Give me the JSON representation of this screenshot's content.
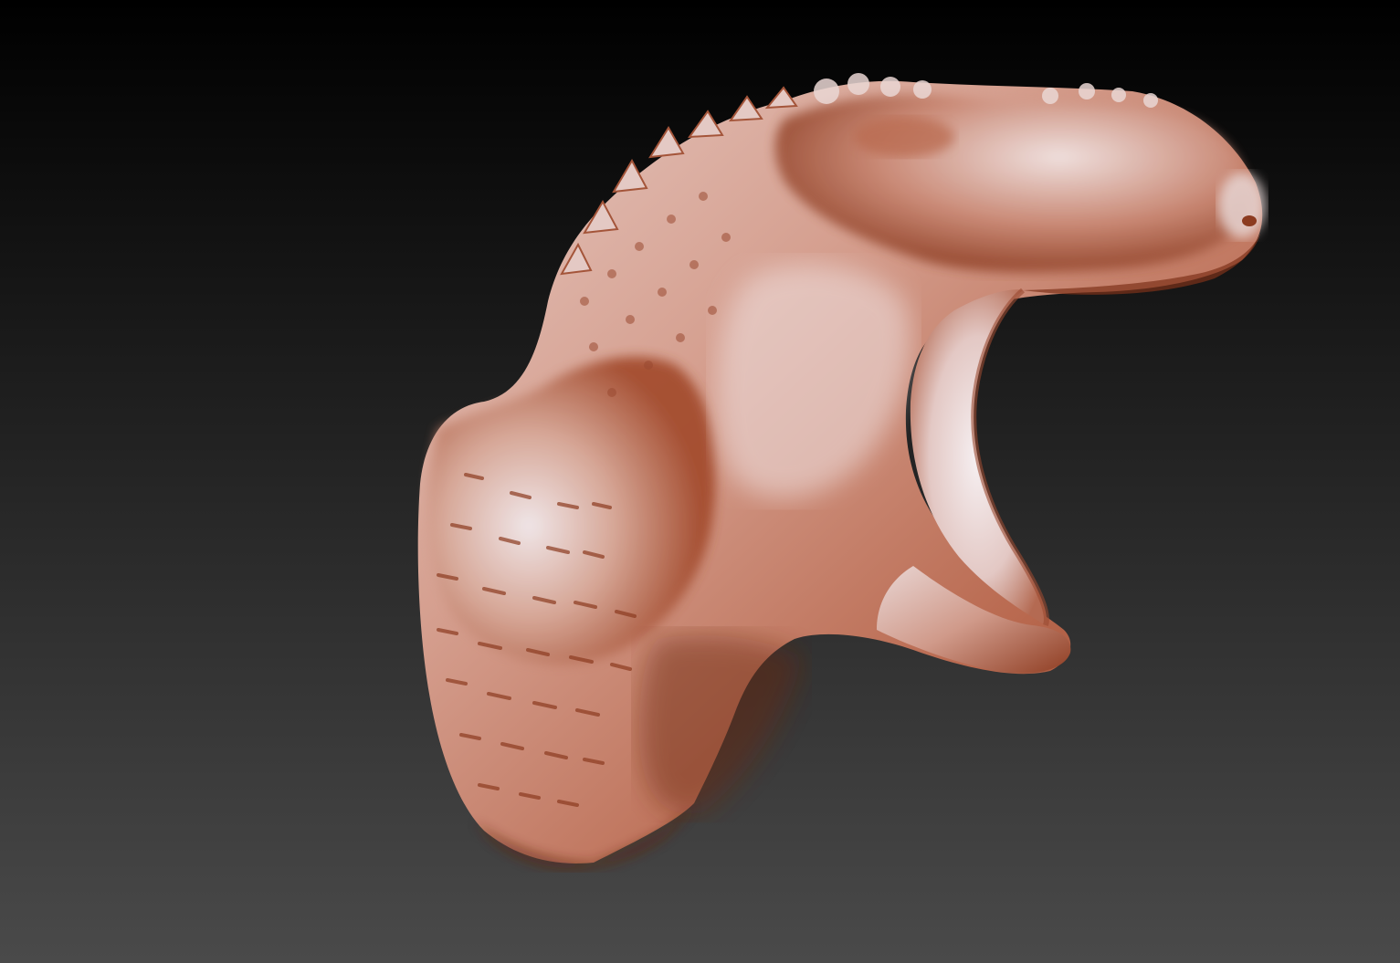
{
  "viewport": {
    "subject": "sculpted-reptile-head-bust",
    "background_top_color": "#000000",
    "background_bottom_color": "#4a4a4a",
    "material_highlight_color": "#f3eef2",
    "material_mid_color": "#c98874",
    "material_shadow_color": "#7a2e14"
  }
}
